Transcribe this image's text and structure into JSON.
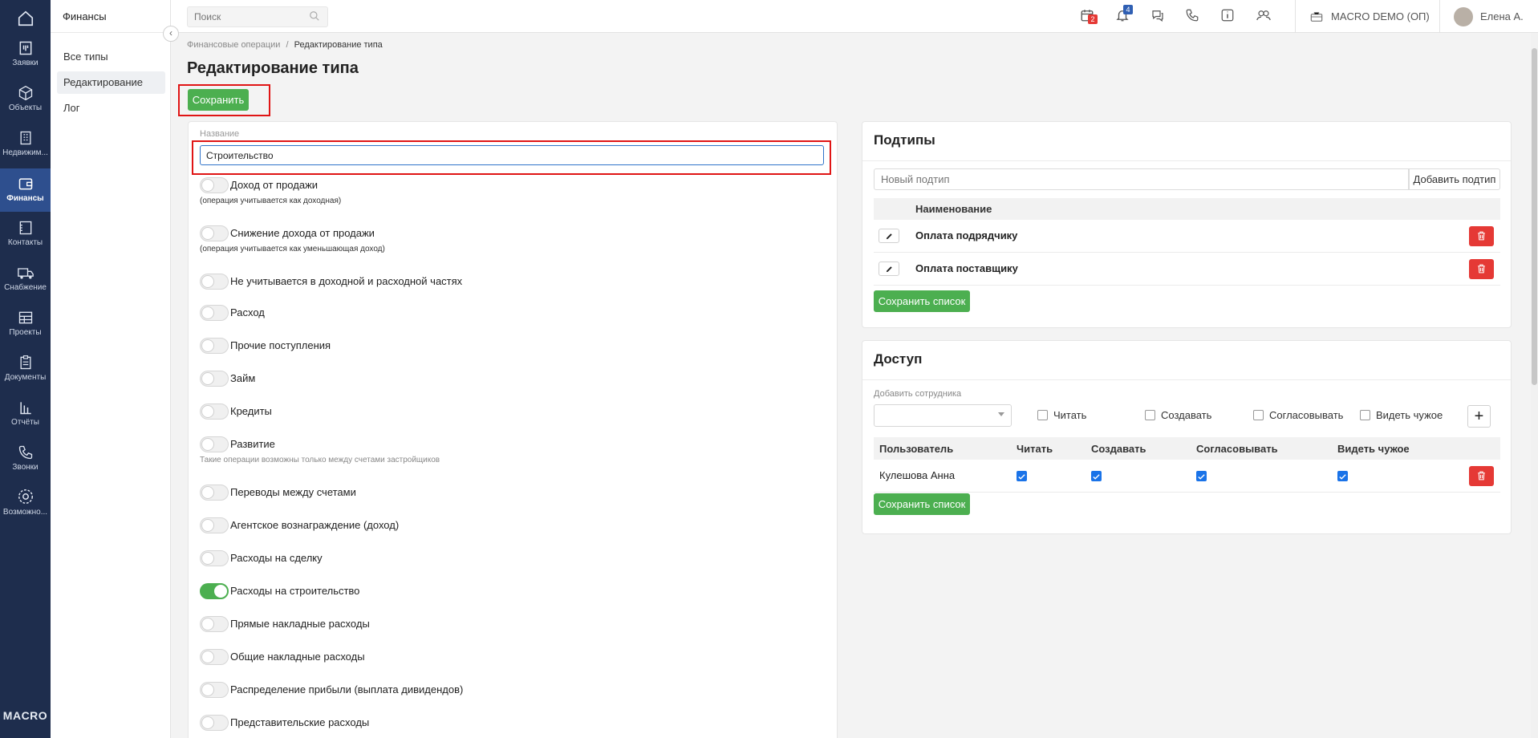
{
  "rail": {
    "items": [
      {
        "label": "",
        "icon": "home-icon"
      },
      {
        "label": "Заявки",
        "icon": "requests-icon"
      },
      {
        "label": "Объекты",
        "icon": "cube-icon"
      },
      {
        "label": "Недвижим...",
        "icon": "building-icon"
      },
      {
        "label": "Финансы",
        "icon": "wallet-icon"
      },
      {
        "label": "Контакты",
        "icon": "contacts-icon"
      },
      {
        "label": "Снабжение",
        "icon": "truck-icon"
      },
      {
        "label": "Проекты",
        "icon": "projects-icon"
      },
      {
        "label": "Документы",
        "icon": "documents-icon"
      },
      {
        "label": "Отчёты",
        "icon": "reports-icon"
      },
      {
        "label": "Звонки",
        "icon": "phone-icon"
      },
      {
        "label": "Возможно...",
        "icon": "settings-icon"
      }
    ],
    "logo": "MACRO"
  },
  "subsidebar": {
    "title": "Финансы",
    "items": [
      "Все типы",
      "Редактирование",
      "Лог"
    ]
  },
  "topbar": {
    "search_placeholder": "Поиск",
    "calendar_badge": "2",
    "notifications_badge": "4",
    "company": "MACRO DEMO (ОП)",
    "user": "Елена А."
  },
  "breadcrumb": {
    "parent": "Финансовые операции",
    "separator": "/",
    "current": "Редактирование типа"
  },
  "page": {
    "title": "Редактирование типа",
    "save_label": "Сохранить"
  },
  "form": {
    "name_label": "Название",
    "name_value": "Строительство",
    "toggles": [
      {
        "label": "Доход от продажи",
        "on": false,
        "hint": "(операция учитывается как доходная)"
      },
      {
        "label": "Снижение дохода от продажи",
        "on": false,
        "hint": "(операция учитывается как уменьшающая доход)"
      },
      {
        "label": "Не учитывается в доходной и расходной частях",
        "on": false
      },
      {
        "label": "Расход",
        "on": false
      },
      {
        "label": "Прочие поступления",
        "on": false
      },
      {
        "label": "Займ",
        "on": false
      },
      {
        "label": "Кредиты",
        "on": false
      },
      {
        "label": "Развитие",
        "on": false,
        "hint": "Такие операции возможны только между счетами застройщиков"
      },
      {
        "label": "Переводы между счетами",
        "on": false
      },
      {
        "label": "Агентское вознаграждение (доход)",
        "on": false
      },
      {
        "label": "Расходы на сделку",
        "on": false
      },
      {
        "label": "Расходы на строительство",
        "on": true
      },
      {
        "label": "Прямые накладные расходы",
        "on": false
      },
      {
        "label": "Общие накладные расходы",
        "on": false
      },
      {
        "label": "Распределение прибыли (выплата дивидендов)",
        "on": false
      },
      {
        "label": "Представительские расходы",
        "on": false
      }
    ]
  },
  "subtypes": {
    "title": "Подтипы",
    "new_placeholder": "Новый подтип",
    "add_label": "Добавить подтип",
    "col_name": "Наименование",
    "rows": [
      "Оплата подрядчику",
      "Оплата поставщику"
    ],
    "save_list_label": "Сохранить список"
  },
  "access": {
    "title": "Доступ",
    "add_employee_label": "Добавить сотрудника",
    "perm_labels": [
      "Читать",
      "Создавать",
      "Согласовывать",
      "Видеть чужое"
    ],
    "columns": [
      "Пользователь",
      "Читать",
      "Создавать",
      "Согласовывать",
      "Видеть чужое"
    ],
    "rows": [
      {
        "user": "Кулешова Анна",
        "read": true,
        "create": true,
        "approve": true,
        "see_others": true
      }
    ],
    "save_list_label": "Сохранить список"
  },
  "colors": {
    "rail_bg": "#1e2d4d",
    "rail_active": "#2e4f8e",
    "accent_green": "#4caf50",
    "danger_red": "#e53935",
    "highlight_red": "#e01515",
    "focus_blue": "#2f73c9"
  }
}
